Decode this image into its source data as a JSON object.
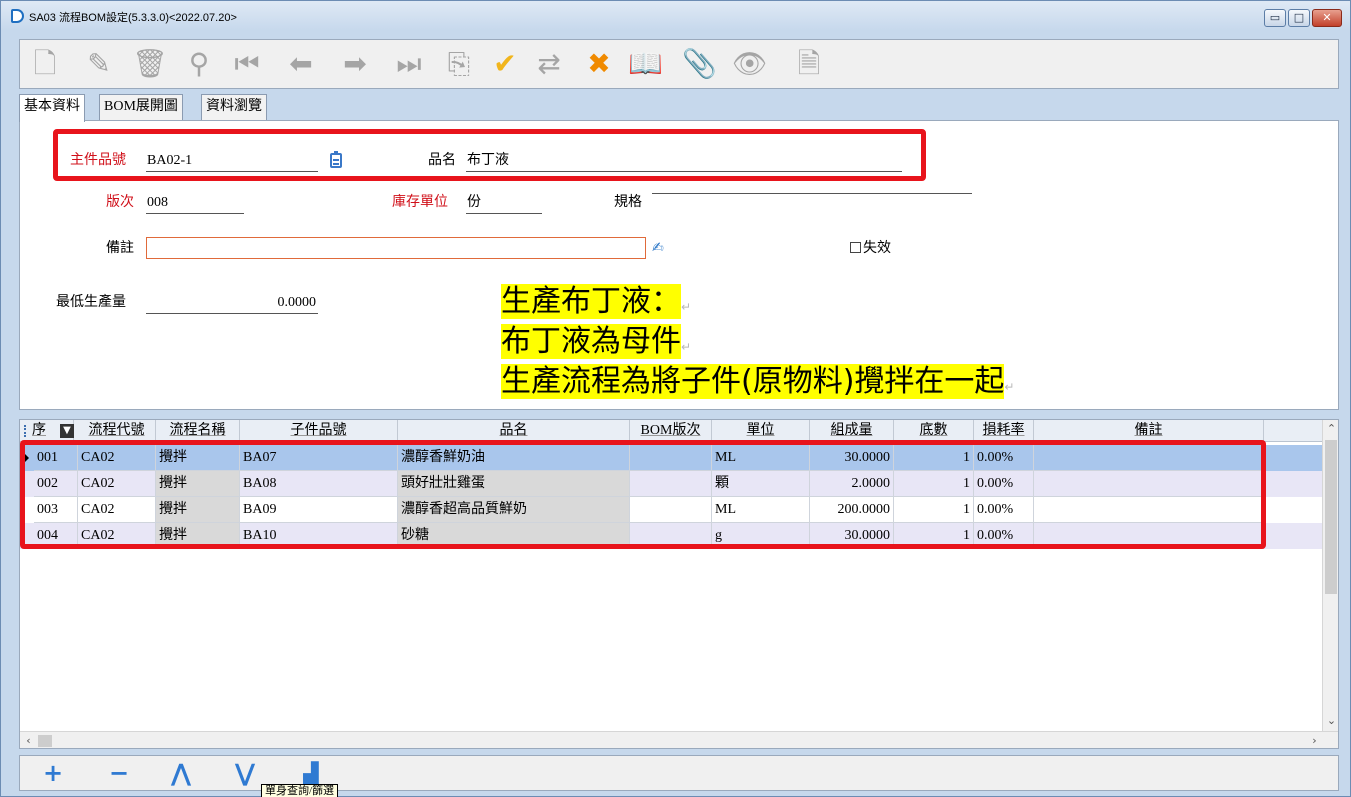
{
  "window": {
    "title": "SA03 流程BOM設定(5.3.3.0)<2022.07.20>",
    "controls": {
      "minimize": "▭",
      "maximize": "□",
      "close": "✕"
    }
  },
  "toolbar": {
    "icons": [
      "new-icon",
      "edit-icon",
      "delete-icon",
      "search-icon",
      "first-record-icon",
      "previous-record-icon",
      "next-record-icon",
      "last-record-icon",
      "copy-icon",
      "confirm-icon",
      "refresh-icon",
      "cancel-icon",
      "manual-icon",
      "attachment-icon",
      "preview-icon",
      "excel-export-icon"
    ]
  },
  "tabs": [
    {
      "label": "基本資料",
      "active": true
    },
    {
      "label": "BOM展開圖",
      "active": false
    },
    {
      "label": "資料瀏覽",
      "active": false
    }
  ],
  "form": {
    "main_item_no": {
      "label": "主件品號",
      "value": "BA02-1"
    },
    "item_name": {
      "label": "品名",
      "value": "布丁液"
    },
    "version": {
      "label": "版次",
      "value": "008"
    },
    "stock_unit": {
      "label": "庫存單位",
      "value": "份"
    },
    "spec": {
      "label": "規格",
      "value": ""
    },
    "remark": {
      "label": "備註",
      "value": ""
    },
    "invalid": {
      "label": "失效",
      "checked": false
    },
    "min_qty": {
      "label": "最低生產量",
      "value": "0.0000"
    }
  },
  "annotation": {
    "line1": "生產布丁液：",
    "line2": "布丁液為母件",
    "line3": "生產流程為將子件(原物料)攪拌在一起",
    "paragraph_mark": "↵"
  },
  "grid": {
    "columns": [
      "序",
      "流程代號",
      "流程名稱",
      "子件品號",
      "品名",
      "BOM版次",
      "單位",
      "組成量",
      "底數",
      "損耗率",
      "備註"
    ],
    "rows": [
      {
        "seq": "001",
        "proc_code": "CA02",
        "proc_name": "攪拌",
        "sub_item": "BA07",
        "name": "濃醇香鮮奶油",
        "bom_ver": "",
        "unit": "ML",
        "qty": "30.0000",
        "base": "1",
        "loss": "0.00%",
        "remark": ""
      },
      {
        "seq": "002",
        "proc_code": "CA02",
        "proc_name": "攪拌",
        "sub_item": "BA08",
        "name": "頭好壯壯雞蛋",
        "bom_ver": "",
        "unit": "顆",
        "qty": "2.0000",
        "base": "1",
        "loss": "0.00%",
        "remark": ""
      },
      {
        "seq": "003",
        "proc_code": "CA02",
        "proc_name": "攪拌",
        "sub_item": "BA09",
        "name": "濃醇香超高品質鮮奶",
        "bom_ver": "",
        "unit": "ML",
        "qty": "200.0000",
        "base": "1",
        "loss": "0.00%",
        "remark": ""
      },
      {
        "seq": "004",
        "proc_code": "CA02",
        "proc_name": "攪拌",
        "sub_item": "BA10",
        "name": "砂糖",
        "bom_ver": "",
        "unit": "g",
        "qty": "30.0000",
        "base": "1",
        "loss": "0.00%",
        "remark": ""
      }
    ]
  },
  "bottom_toolbar": {
    "add": "+",
    "remove": "−",
    "move_up": "⋀",
    "move_down": "⋁",
    "tooltip": "單身查詢/篩選"
  },
  "colors": {
    "highlight_frame": "#e8141c",
    "annotation_highlight": "#ffff00",
    "required_label": "#d0101a",
    "selected_row": "#a9c6ec"
  }
}
